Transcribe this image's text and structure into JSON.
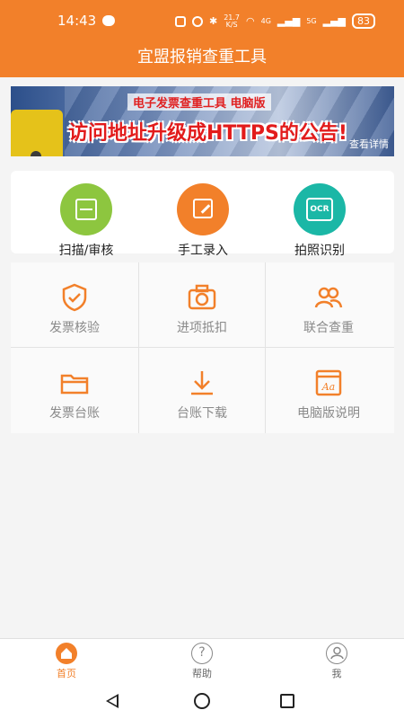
{
  "status_bar": {
    "time": "14:43",
    "net_speed_top": "21.7",
    "net_speed_unit": "K/S",
    "signal_a": "4G",
    "signal_b": "5G",
    "battery": "83"
  },
  "app_bar": {
    "title": "宜盟报销查重工具"
  },
  "banner": {
    "subtitle": "电子发票查重工具  电脑版",
    "headline": "访问地址升级成HTTPS的公告!",
    "detail_link": "查看详情"
  },
  "quick_actions": [
    {
      "label": "扫描/审核",
      "color": "#8dc63f",
      "icon": "scan-icon"
    },
    {
      "label": "手工录入",
      "color": "#f2802a",
      "icon": "edit-icon"
    },
    {
      "label": "拍照识别",
      "color": "#1bb7a6",
      "icon": "ocr-icon"
    }
  ],
  "grid": [
    {
      "label": "发票核验",
      "icon": "shield-check-icon"
    },
    {
      "label": "进项抵扣",
      "icon": "camera-icon"
    },
    {
      "label": "联合查重",
      "icon": "users-icon"
    },
    {
      "label": "发票台账",
      "icon": "folder-icon"
    },
    {
      "label": "台账下载",
      "icon": "download-icon"
    },
    {
      "label": "电脑版说明",
      "icon": "font-doc-icon"
    }
  ],
  "accent_color": "#f2802a",
  "tabs": [
    {
      "label": "首页",
      "icon": "home-icon",
      "active": true
    },
    {
      "label": "帮助",
      "icon": "help-icon",
      "active": false
    },
    {
      "label": "我",
      "icon": "profile-icon",
      "active": false
    }
  ]
}
